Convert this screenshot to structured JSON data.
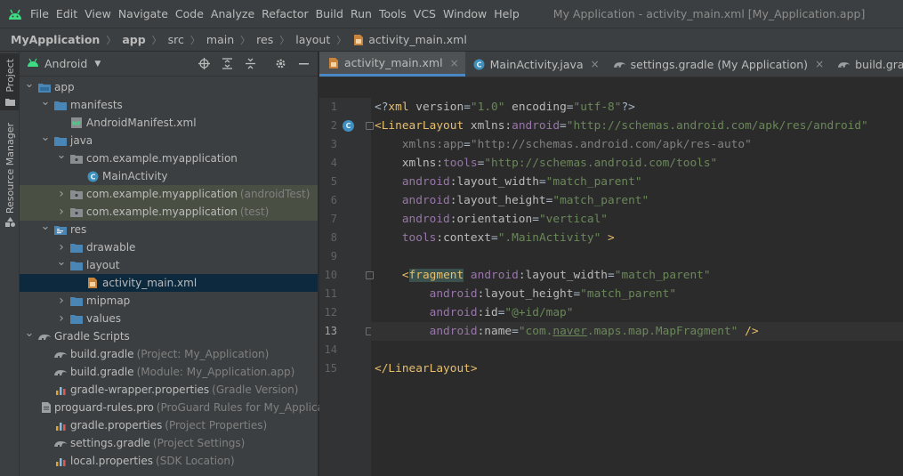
{
  "menu": {
    "items": [
      "File",
      "Edit",
      "View",
      "Navigate",
      "Code",
      "Analyze",
      "Refactor",
      "Build",
      "Run",
      "Tools",
      "VCS",
      "Window",
      "Help"
    ],
    "window_title": "My Application - activity_main.xml [My_Application.app]"
  },
  "breadcrumb": {
    "items": [
      "MyApplication",
      "app",
      "src",
      "main",
      "res",
      "layout",
      "activity_main.xml"
    ]
  },
  "toolstrip": {
    "project_label": "Project",
    "resource_label": "Resource Manager"
  },
  "project_panel": {
    "view_mode": "Android",
    "rows": [
      {
        "label": "app",
        "hint": "",
        "depth": 0,
        "arrow": "open",
        "icon": "module-folder-icon"
      },
      {
        "label": "manifests",
        "hint": "",
        "depth": 1,
        "arrow": "open",
        "icon": "folder-icon"
      },
      {
        "label": "AndroidManifest.xml",
        "hint": "",
        "depth": 2,
        "arrow": "none",
        "icon": "manifest-icon"
      },
      {
        "label": "java",
        "hint": "",
        "depth": 1,
        "arrow": "open",
        "icon": "folder-icon"
      },
      {
        "label": "com.example.myapplication",
        "hint": "",
        "depth": 2,
        "arrow": "open",
        "icon": "package-icon"
      },
      {
        "label": "MainActivity",
        "hint": "",
        "depth": 3,
        "arrow": "none",
        "icon": "class-icon"
      },
      {
        "label": "com.example.myapplication",
        "hint": "(androidTest)",
        "depth": 2,
        "arrow": "closed",
        "icon": "package-icon",
        "highlight": true
      },
      {
        "label": "com.example.myapplication",
        "hint": "(test)",
        "depth": 2,
        "arrow": "closed",
        "icon": "package-icon",
        "highlight": true
      },
      {
        "label": "res",
        "hint": "",
        "depth": 1,
        "arrow": "open",
        "icon": "res-folder-icon"
      },
      {
        "label": "drawable",
        "hint": "",
        "depth": 2,
        "arrow": "closed",
        "icon": "folder-icon"
      },
      {
        "label": "layout",
        "hint": "",
        "depth": 2,
        "arrow": "open",
        "icon": "folder-icon"
      },
      {
        "label": "activity_main.xml",
        "hint": "",
        "depth": 3,
        "arrow": "none",
        "icon": "layout-xml-icon",
        "selected": true
      },
      {
        "label": "mipmap",
        "hint": "",
        "depth": 2,
        "arrow": "closed",
        "icon": "folder-icon"
      },
      {
        "label": "values",
        "hint": "",
        "depth": 2,
        "arrow": "closed",
        "icon": "folder-icon"
      },
      {
        "label": "Gradle Scripts",
        "hint": "",
        "depth": 0,
        "arrow": "open",
        "icon": "gradle-icon"
      },
      {
        "label": "build.gradle",
        "hint": "(Project: My_Application)",
        "depth": 1,
        "arrow": "none",
        "icon": "gradle-icon"
      },
      {
        "label": "build.gradle",
        "hint": "(Module: My_Application.app)",
        "depth": 1,
        "arrow": "none",
        "icon": "gradle-icon"
      },
      {
        "label": "gradle-wrapper.properties",
        "hint": "(Gradle Version)",
        "depth": 1,
        "arrow": "none",
        "icon": "properties-icon"
      },
      {
        "label": "proguard-rules.pro",
        "hint": "(ProGuard Rules for My_Applica",
        "depth": 1,
        "arrow": "none",
        "icon": "text-file-icon"
      },
      {
        "label": "gradle.properties",
        "hint": "(Project Properties)",
        "depth": 1,
        "arrow": "none",
        "icon": "properties-icon"
      },
      {
        "label": "settings.gradle",
        "hint": "(Project Settings)",
        "depth": 1,
        "arrow": "none",
        "icon": "gradle-icon"
      },
      {
        "label": "local.properties",
        "hint": "(SDK Location)",
        "depth": 1,
        "arrow": "none",
        "icon": "properties-icon"
      }
    ]
  },
  "editor": {
    "tabs": [
      {
        "label": "activity_main.xml",
        "icon": "layout-xml-icon",
        "active": true
      },
      {
        "label": "MainActivity.java",
        "icon": "class-icon",
        "active": false
      },
      {
        "label": "settings.gradle (My Application)",
        "icon": "gradle-icon",
        "active": false
      },
      {
        "label": "build.gradle (:app)",
        "icon": "gradle-icon",
        "active": false
      }
    ],
    "current_line": 13,
    "lines": [
      {
        "n": "1",
        "t": [
          [
            "plain",
            "<?"
          ],
          [
            "tag",
            "xml "
          ],
          [
            "attr",
            "version"
          ],
          [
            "plain",
            "="
          ],
          [
            "val",
            "\"1.0\""
          ],
          [
            "plain",
            " "
          ],
          [
            "attr",
            "encoding"
          ],
          [
            "plain",
            "="
          ],
          [
            "val",
            "\"utf-8\""
          ],
          [
            "plain",
            "?>"
          ]
        ]
      },
      {
        "n": "2",
        "t": [
          [
            "tag",
            "<LinearLayout "
          ],
          [
            "attr",
            "xmlns:"
          ],
          [
            "ns",
            "android"
          ],
          [
            "plain",
            "="
          ],
          [
            "val",
            "\"http://schemas.android.com/apk/res/android\""
          ]
        ]
      },
      {
        "n": "3",
        "t": [
          [
            "plain",
            "    "
          ],
          [
            "dim",
            "xmlns:app"
          ],
          [
            "plain",
            "="
          ],
          [
            "dimval",
            "\"http://schemas.android.com/apk/res-auto\""
          ]
        ]
      },
      {
        "n": "4",
        "t": [
          [
            "plain",
            "    "
          ],
          [
            "attr",
            "xmlns:"
          ],
          [
            "ns",
            "tools"
          ],
          [
            "plain",
            "="
          ],
          [
            "val",
            "\"http://schemas.android.com/tools\""
          ]
        ]
      },
      {
        "n": "5",
        "t": [
          [
            "plain",
            "    "
          ],
          [
            "ns",
            "android"
          ],
          [
            "attr",
            ":layout_width"
          ],
          [
            "plain",
            "="
          ],
          [
            "val",
            "\"match_parent\""
          ]
        ]
      },
      {
        "n": "6",
        "t": [
          [
            "plain",
            "    "
          ],
          [
            "ns",
            "android"
          ],
          [
            "attr",
            ":layout_height"
          ],
          [
            "plain",
            "="
          ],
          [
            "val",
            "\"match_parent\""
          ]
        ]
      },
      {
        "n": "7",
        "t": [
          [
            "plain",
            "    "
          ],
          [
            "ns",
            "android"
          ],
          [
            "attr",
            ":orientation"
          ],
          [
            "plain",
            "="
          ],
          [
            "val",
            "\"vertical\""
          ]
        ]
      },
      {
        "n": "8",
        "t": [
          [
            "plain",
            "    "
          ],
          [
            "ns",
            "tools"
          ],
          [
            "attr",
            ":context"
          ],
          [
            "plain",
            "="
          ],
          [
            "val",
            "\".MainActivity\""
          ],
          [
            "plain",
            " "
          ],
          [
            "tag",
            ">"
          ]
        ]
      },
      {
        "n": "9",
        "t": []
      },
      {
        "n": "10",
        "t": [
          [
            "plain",
            "    "
          ],
          [
            "tag",
            "<"
          ],
          [
            "taghl",
            "fragment"
          ],
          [
            "plain",
            " "
          ],
          [
            "ns",
            "android"
          ],
          [
            "attr",
            ":layout_width"
          ],
          [
            "plain",
            "="
          ],
          [
            "val",
            "\"match_parent\""
          ]
        ]
      },
      {
        "n": "11",
        "t": [
          [
            "plain",
            "        "
          ],
          [
            "ns",
            "android"
          ],
          [
            "attr",
            ":layout_height"
          ],
          [
            "plain",
            "="
          ],
          [
            "val",
            "\"match_parent\""
          ]
        ]
      },
      {
        "n": "12",
        "t": [
          [
            "plain",
            "        "
          ],
          [
            "ns",
            "android"
          ],
          [
            "attr",
            ":id"
          ],
          [
            "plain",
            "="
          ],
          [
            "val",
            "\"@+id/map\""
          ]
        ]
      },
      {
        "n": "13",
        "t": [
          [
            "plain",
            "        "
          ],
          [
            "ns",
            "android"
          ],
          [
            "attr",
            ":name"
          ],
          [
            "plain",
            "="
          ],
          [
            "val",
            "\"com."
          ],
          [
            "valul",
            "naver"
          ],
          [
            "val",
            ".maps.map.MapFragment\""
          ],
          [
            "plain",
            " "
          ],
          [
            "tag",
            "/>"
          ]
        ]
      },
      {
        "n": "14",
        "t": []
      },
      {
        "n": "15",
        "t": [
          [
            "tag",
            "</LinearLayout>"
          ]
        ]
      }
    ]
  }
}
